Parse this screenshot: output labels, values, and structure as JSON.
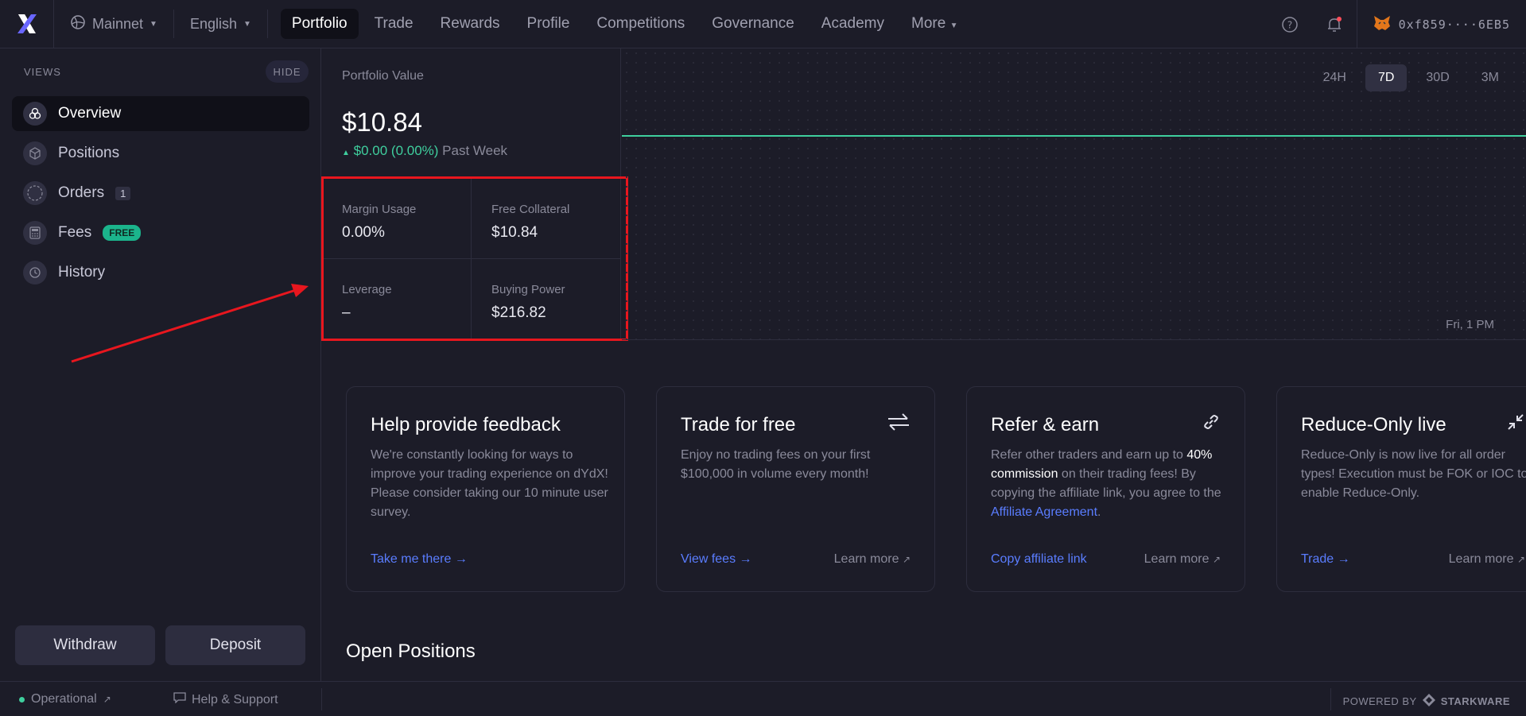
{
  "topbar": {
    "network": "Mainnet",
    "language": "English",
    "nav": [
      "Portfolio",
      "Trade",
      "Rewards",
      "Profile",
      "Competitions",
      "Governance",
      "Academy",
      "More"
    ],
    "active_nav": "Portfolio",
    "wallet": "0xf859····6EB5"
  },
  "sidebar": {
    "views_label": "VIEWS",
    "hide_label": "HIDE",
    "items": [
      {
        "label": "Overview",
        "icon": "overview-icon"
      },
      {
        "label": "Positions",
        "icon": "cube-icon"
      },
      {
        "label": "Orders",
        "icon": "dashed-circle-icon",
        "badge": "1"
      },
      {
        "label": "Fees",
        "icon": "calculator-icon",
        "badge": "FREE"
      },
      {
        "label": "History",
        "icon": "clock-history-icon"
      }
    ],
    "withdraw_label": "Withdraw",
    "deposit_label": "Deposit"
  },
  "portfolio": {
    "label": "Portfolio Value",
    "value": "$10.84",
    "change": "$0.00 (0.00%)",
    "change_period": "Past Week",
    "metrics": {
      "margin_usage_label": "Margin Usage",
      "margin_usage_value": "0.00%",
      "free_collateral_label": "Free Collateral",
      "free_collateral_value": "$10.84",
      "leverage_label": "Leverage",
      "leverage_value": "–",
      "buying_power_label": "Buying Power",
      "buying_power_value": "$216.82"
    }
  },
  "chart": {
    "ranges": [
      "24H",
      "7D",
      "30D",
      "3M"
    ],
    "active_range": "7D",
    "date_label": "Fri, 1 PM",
    "line_color": "#3fcf9e"
  },
  "cards": [
    {
      "title": "Help provide feedback",
      "body": "We're constantly looking for ways to improve your trading experience on dYdX! Please consider taking our 10 minute user survey.",
      "link": "Take me there →",
      "learn": ""
    },
    {
      "title": "Trade for free",
      "body": "Enjoy no trading fees on your first $100,000 in volume every month!",
      "link": "View fees →",
      "learn": "Learn more"
    },
    {
      "title": "Refer & earn",
      "body_pre": "Refer other traders and earn up to ",
      "body_bold": "40% commission",
      "body_mid": " on their trading fees! By copying the affiliate link, you agree to the ",
      "body_link": "Affiliate Agreement",
      "body_post": ".",
      "link": "Copy affiliate link",
      "learn": "Learn more"
    },
    {
      "title": "Reduce-Only live",
      "body": "Reduce-Only is now live for all order types! Execution must be FOK or IOC to enable Reduce-Only.",
      "link": "Trade →",
      "learn": "Learn more"
    }
  ],
  "open_positions_title": "Open Positions",
  "footer": {
    "status": "Operational",
    "help": "Help & Support",
    "powered_by": "POWERED BY",
    "brand": "STARKWARE"
  },
  "colors": {
    "accent_blue": "#5a7dff",
    "positive": "#3fcf9e",
    "highlight_red": "#e8161e"
  }
}
